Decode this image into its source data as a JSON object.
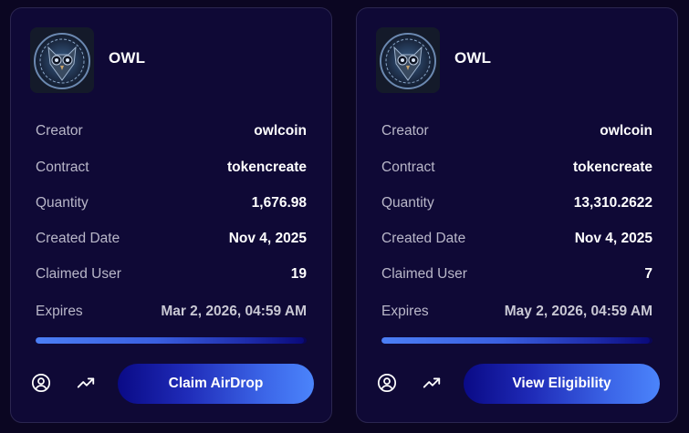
{
  "cards": [
    {
      "token_name": "OWL",
      "avatar_icon": "owl-logo-icon",
      "fields": [
        {
          "label": "Creator",
          "value": "owlcoin"
        },
        {
          "label": "Contract",
          "value": "tokencreate"
        },
        {
          "label": "Quantity",
          "value": "1,676.98"
        },
        {
          "label": "Created Date",
          "value": "Nov 4, 2025"
        },
        {
          "label": "Claimed User",
          "value": "19"
        },
        {
          "label": "Expires",
          "value": "Mar 2, 2026, 04:59 AM"
        }
      ],
      "progress_fraction": 0.99,
      "action_label": "Claim AirDrop"
    },
    {
      "token_name": "OWL",
      "avatar_icon": "owl-logo-icon",
      "fields": [
        {
          "label": "Creator",
          "value": "owlcoin"
        },
        {
          "label": "Contract",
          "value": "tokencreate"
        },
        {
          "label": "Quantity",
          "value": "13,310.2622"
        },
        {
          "label": "Created Date",
          "value": "Nov 4, 2025"
        },
        {
          "label": "Claimed User",
          "value": "7"
        },
        {
          "label": "Expires",
          "value": "May 2, 2026, 04:59 AM"
        }
      ],
      "progress_fraction": 0.99,
      "action_label": "View Eligibility"
    }
  ],
  "colors": {
    "background": "#0b0622",
    "card": "#0f0936",
    "accent": "#4b84fb",
    "label_text": "#b9b7c9"
  },
  "icons": {
    "profile": "user-circle-icon",
    "stats": "trending-up-icon"
  }
}
